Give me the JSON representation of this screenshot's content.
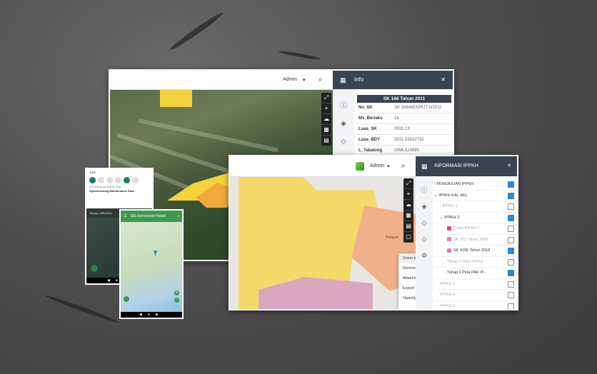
{
  "shot1": {
    "admin_label": "Admin",
    "panel_title": "Info",
    "table_title": "SK 166 Tahun 2011",
    "rows": [
      {
        "k": "No_SK",
        "v": "SK.166/MENHUT-II/2011"
      },
      {
        "k": "Ms_Berlaku",
        "v": "16"
      },
      {
        "k": "Luas_SK",
        "v": "3531.13"
      },
      {
        "k": "Luas_BDY",
        "v": "3531.03032732"
      },
      {
        "k": "L_Tabalong",
        "v": "2996.624885"
      }
    ]
  },
  "phone1": {
    "time": "3:24",
    "notif1": "SIG Kehutanan Kalsel · now",
    "notif2": "Synchronizing Maintenance Data",
    "manage": "Manage notifications"
  },
  "phone2": {
    "app_title": "SIG Kehutanan Kalsel"
  },
  "shot2": {
    "admin_label": "Admin",
    "panel_title": "INFORMASI IPPKH",
    "tree": [
      {
        "label": "PENGAJUAN IPPKH",
        "arrow": "›",
        "indent": 0,
        "checked": true,
        "dim": false
      },
      {
        "label": "IPPKH KAL-SEL",
        "arrow": "⌄",
        "indent": 0,
        "checked": true,
        "dim": false
      },
      {
        "label": "IPPKH 1",
        "arrow": "›",
        "indent": 8,
        "checked": false,
        "dim": true
      },
      {
        "label": "IPPKH 2",
        "arrow": "⌄",
        "indent": 8,
        "checked": true,
        "dim": false
      },
      {
        "label": "Potok IPPKH 2",
        "arrow": "",
        "indent": 18,
        "checked": false,
        "dim": true,
        "swatch": "#e8457a"
      },
      {
        "label": "SK 373 Tahun 2008",
        "arrow": "",
        "indent": 18,
        "checked": false,
        "dim": true,
        "swatch": "#d77fc1"
      },
      {
        "label": "SK 4165 Tahun 2018",
        "arrow": "",
        "indent": 18,
        "checked": true,
        "dim": false,
        "swatch": "#d77fc1"
      },
      {
        "label": "Tahap 2 Peta IPPKH",
        "arrow": "",
        "indent": 18,
        "checked": false,
        "dim": true
      },
      {
        "label": "Tahap 2 Peta PAK IP...",
        "arrow": "",
        "indent": 18,
        "checked": true,
        "dim": false
      },
      {
        "label": "IPPKH 3",
        "arrow": "",
        "indent": 8,
        "checked": false,
        "dim": true
      },
      {
        "label": "IPPKH 4",
        "arrow": "",
        "indent": 8,
        "checked": false,
        "dim": true
      },
      {
        "label": "IPPKH 5",
        "arrow": "",
        "indent": 8,
        "checked": false,
        "dim": true
      }
    ],
    "context_menu": [
      "Zoom to layer",
      "Remove layer",
      "Attachment",
      "Export",
      "Opacity"
    ],
    "map_label": "Petapan"
  }
}
